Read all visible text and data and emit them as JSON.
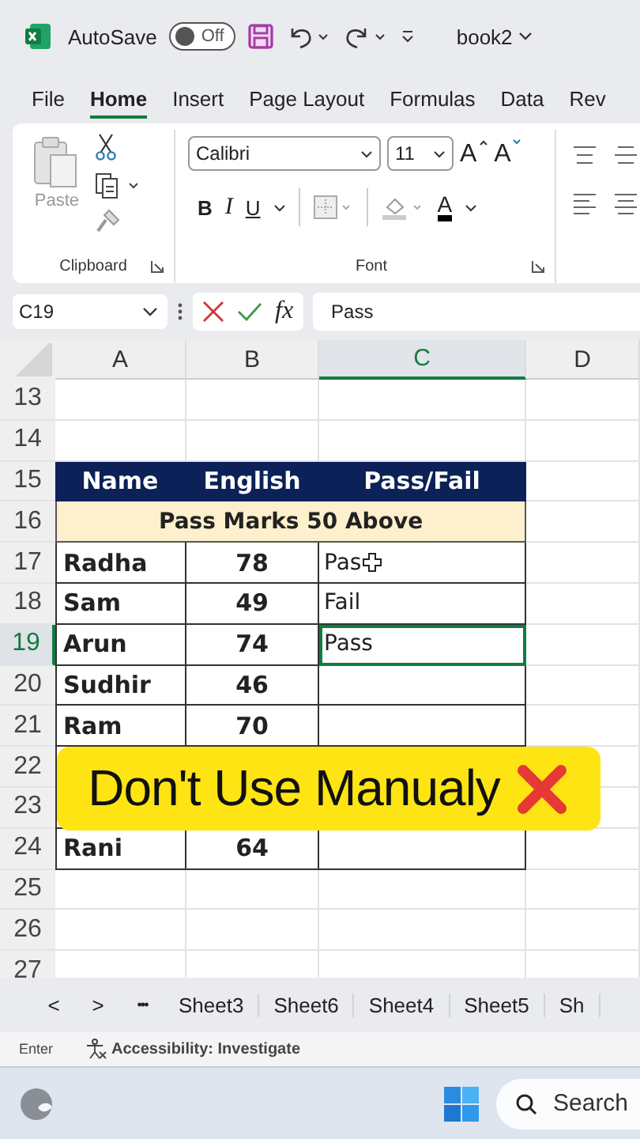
{
  "title_bar": {
    "autosave_label": "AutoSave",
    "autosave": {
      "on": false,
      "label": "Off"
    },
    "file_name": "book2"
  },
  "tabs": [
    {
      "label": "File",
      "selected": false
    },
    {
      "label": "Home",
      "selected": true
    },
    {
      "label": "Insert",
      "selected": false
    },
    {
      "label": "Page Layout",
      "selected": false
    },
    {
      "label": "Formulas",
      "selected": false
    },
    {
      "label": "Data",
      "selected": false
    },
    {
      "label": "Rev",
      "selected": false
    }
  ],
  "ribbon": {
    "clipboard": {
      "paste_label": "Paste",
      "group_label": "Clipboard"
    },
    "font": {
      "font_name": "Calibri",
      "font_size": "11",
      "grow": "A",
      "shrink": "A",
      "bold": "B",
      "italic": "I",
      "underline": "U",
      "font_color": "A",
      "group_label": "Font"
    }
  },
  "formula_bar": {
    "name_box": "C19",
    "fx": "fx",
    "value": "Pass"
  },
  "columns": [
    {
      "label": "A",
      "selected": false
    },
    {
      "label": "B",
      "selected": false
    },
    {
      "label": "C",
      "selected": true
    },
    {
      "label": "D",
      "selected": false
    }
  ],
  "rows": [
    {
      "number": "13",
      "kind": "blank",
      "selected": false
    },
    {
      "number": "14",
      "kind": "blank",
      "selected": false
    },
    {
      "number": "15",
      "kind": "header",
      "selected": false,
      "cells": [
        "Name",
        "English",
        "Pass/Fail"
      ]
    },
    {
      "number": "16",
      "kind": "note",
      "selected": false,
      "cells": [
        "Pass Marks 50 Above"
      ]
    },
    {
      "number": "17",
      "kind": "data",
      "selected": false,
      "cells": [
        "Radha",
        "78",
        "Pas"
      ],
      "cursor": true
    },
    {
      "number": "18",
      "kind": "data",
      "selected": false,
      "cells": [
        "Sam",
        "49",
        "Fail"
      ]
    },
    {
      "number": "19",
      "kind": "data",
      "selected": true,
      "cells": [
        "Arun",
        "74",
        "Pass"
      ]
    },
    {
      "number": "20",
      "kind": "data",
      "selected": false,
      "cells": [
        "Sudhir",
        "46",
        ""
      ]
    },
    {
      "number": "21",
      "kind": "data",
      "selected": false,
      "cells": [
        "Ram",
        "70",
        ""
      ]
    },
    {
      "number": "22",
      "kind": "data",
      "selected": false,
      "cells": [
        "",
        "",
        ""
      ]
    },
    {
      "number": "23",
      "kind": "data",
      "selected": false,
      "cells": [
        "",
        "",
        ""
      ]
    },
    {
      "number": "24",
      "kind": "data",
      "selected": false,
      "cells": [
        "Rani",
        "64",
        ""
      ]
    },
    {
      "number": "25",
      "kind": "blank",
      "selected": false
    },
    {
      "number": "26",
      "kind": "blank",
      "selected": false
    },
    {
      "number": "27",
      "kind": "blank",
      "selected": false
    }
  ],
  "overlay_banner": {
    "text": "Don't Use Manualy"
  },
  "sheet_tabs": {
    "prev": "<",
    "next": ">",
    "more": "•••",
    "sheets": [
      "Sheet3",
      "Sheet6",
      "Sheet4",
      "Sheet5",
      "Sh"
    ]
  },
  "status_bar": {
    "mode": "Enter",
    "accessibility": "Accessibility: Investigate"
  },
  "taskbar": {
    "search_placeholder": "Search"
  }
}
